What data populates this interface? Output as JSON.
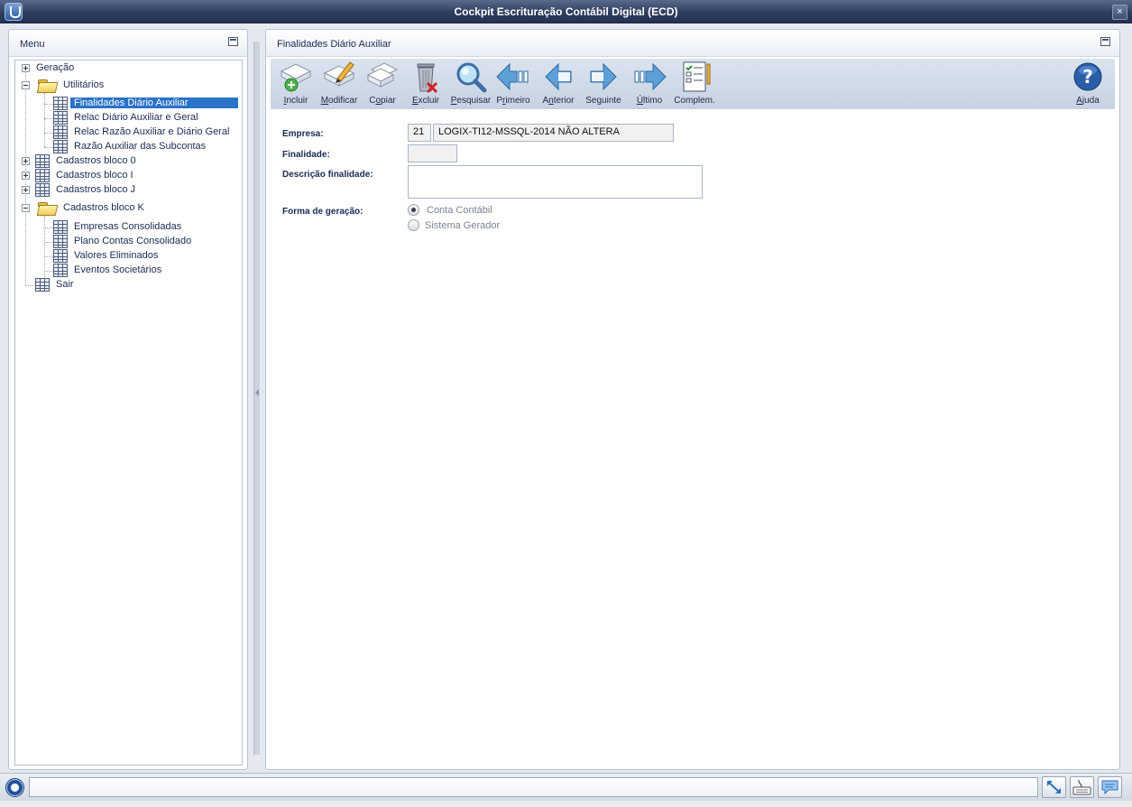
{
  "window": {
    "title": "Cockpit Escrituração Contábil Digital (ECD)",
    "close_label": "×"
  },
  "menu_panel": {
    "title": "Menu",
    "tree": [
      {
        "label": "Geração",
        "icon": "none",
        "toggle": "plus"
      },
      {
        "label": "Utilitários",
        "icon": "folder-open-icon",
        "toggle": "minus"
      },
      {
        "label": "Finalidades Diário Auxiliar",
        "icon": "grid-icon",
        "selected": true
      },
      {
        "label": "Relac Diário Auxiliar e Geral",
        "icon": "grid-icon"
      },
      {
        "label": "Relac Razão Auxiliar e Diário Geral",
        "icon": "grid-icon"
      },
      {
        "label": "Razão Auxiliar das Subcontas",
        "icon": "grid-icon"
      },
      {
        "label": "Cadastros bloco 0",
        "icon": "grid-icon",
        "toggle": "plus"
      },
      {
        "label": "Cadastros bloco I",
        "icon": "grid-icon",
        "toggle": "plus"
      },
      {
        "label": "Cadastros bloco J",
        "icon": "grid-icon",
        "toggle": "plus"
      },
      {
        "label": "Cadastros bloco K",
        "icon": "folder-open-icon",
        "toggle": "minus"
      },
      {
        "label": "Empresas Consolidadas",
        "icon": "grid-icon"
      },
      {
        "label": "Plano Contas Consolidado",
        "icon": "grid-icon"
      },
      {
        "label": "Valores Eliminados",
        "icon": "grid-icon"
      },
      {
        "label": "Eventos Societários",
        "icon": "grid-icon"
      },
      {
        "label": "Sair",
        "icon": "grid-icon"
      }
    ]
  },
  "content_panel": {
    "title": "Finalidades Diário Auxiliar"
  },
  "toolbar": {
    "incluir": {
      "pre": "",
      "u": "I",
      "post": "ncluir"
    },
    "modificar": {
      "pre": "",
      "u": "M",
      "post": "odificar"
    },
    "copiar": {
      "pre": "C",
      "u": "o",
      "post": "piar"
    },
    "excluir": {
      "pre": "",
      "u": "E",
      "post": "xcluir"
    },
    "pesquisar": {
      "pre": "",
      "u": "P",
      "post": "esquisar"
    },
    "primeiro": {
      "pre": "P",
      "u": "r",
      "post": "imeiro"
    },
    "anterior": {
      "pre": "A",
      "u": "n",
      "post": "terior"
    },
    "seguinte": {
      "pre": "Se",
      "u": "g",
      "post": "uinte"
    },
    "ultimo": {
      "pre": "",
      "u": "Ú",
      "post": "ltimo"
    },
    "complem": {
      "pre": "Complem.",
      "u": "",
      "post": ""
    },
    "ajuda": {
      "pre": "",
      "u": "A",
      "post": "juda"
    }
  },
  "form": {
    "empresa_label": "Empresa:",
    "empresa_code": "21",
    "empresa_name": "LOGIX-TI12-MSSQL-2014 NÃO ALTERA",
    "finalidade_label": "Finalidade:",
    "finalidade_value": "",
    "descricao_label": "Descrição finalidade:",
    "descricao_value": "",
    "forma_label": "Forma de geração:",
    "forma_options": [
      "Conta Contábil",
      "Sistema Gerador"
    ],
    "forma_selected": "Conta Contábil"
  },
  "statusbar": {
    "message": ""
  },
  "colors": {
    "title_bar": "#2f3d5e",
    "selection": "#2a72c9",
    "label_text": "#1b2a55"
  }
}
